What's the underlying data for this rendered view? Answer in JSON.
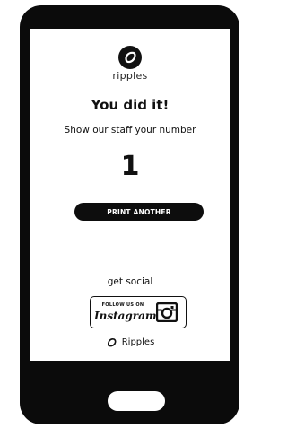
{
  "app": {
    "brand_name": "ripples",
    "logo_icon": "ripples-logo-icon"
  },
  "main": {
    "headline": "You did it!",
    "subtext": "Show our staff your number",
    "number": "1",
    "print_button_label": "PRINT ANOTHER"
  },
  "social": {
    "heading": "get social",
    "badge_follow_text": "FOLLOW US ON",
    "badge_platform_text": "Instagram",
    "badge_icon": "instagram-icon"
  },
  "footer": {
    "brand_text": "Ripples",
    "brand_icon": "ripples-logo-icon"
  },
  "device": {
    "frame_color": "#0b0b0b",
    "screen_color": "#ffffff",
    "home_button_icon": "home-button"
  }
}
